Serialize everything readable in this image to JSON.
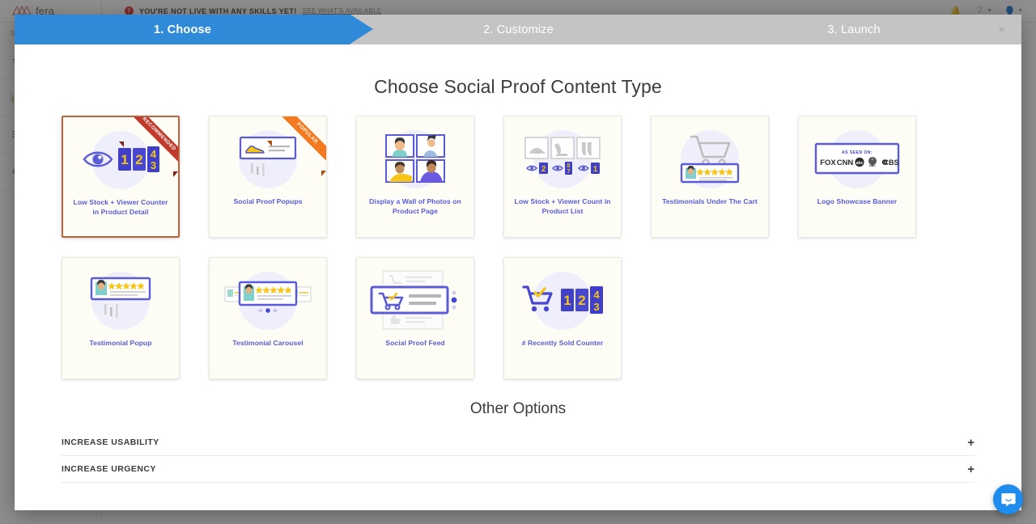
{
  "background": {
    "brand_name": "fera",
    "alert": {
      "icon": "alert-bell-icon",
      "text": "YOU'RE NOT LIVE WITH ANY SKILLS YET!",
      "link_text": "SEE WHAT'S AVAILABLE"
    },
    "topbar_icons": [
      "bell-icon",
      "help-icon",
      "user-avatar-icon"
    ],
    "sidebar": {
      "heading": "SKILLS",
      "items": [
        {
          "label": "",
          "icon": "star-icon"
        },
        {
          "label": "",
          "icon": "chart-icon"
        },
        {
          "label": "",
          "icon": "list-icon"
        },
        {
          "label": "",
          "icon": "gear-icon"
        }
      ]
    }
  },
  "modal": {
    "close_label": "×",
    "steps": [
      {
        "number": "1.",
        "label": "1. Choose",
        "active": true
      },
      {
        "number": "2.",
        "label": "2. Customize",
        "active": false
      },
      {
        "number": "3.",
        "label": "3. Launch",
        "active": false
      }
    ],
    "title": "Choose Social Proof Content Type",
    "cards": [
      {
        "label": "Low Stock + Viewer Counter in Product Detail",
        "art": "eye-counter-digits",
        "ribbon": "RECOMMENDED",
        "ribbon_type": "recommended",
        "selected": true,
        "digits": [
          "1",
          "2",
          "4",
          "3"
        ]
      },
      {
        "label": "Social Proof Popups",
        "art": "popup-shoe-card",
        "ribbon": "POPULAR",
        "ribbon_type": "popular",
        "selected": false
      },
      {
        "label": "Display a Wall of Photos on Product Page",
        "art": "photo-wall-grid",
        "ribbon": null,
        "selected": false
      },
      {
        "label": "Low Stock + Viewer Count in Product List",
        "art": "product-list-viewers",
        "ribbon": null,
        "selected": false,
        "view_counts": [
          "2",
          "",
          "1"
        ]
      },
      {
        "label": "Testimonials Under The Cart",
        "art": "cart-testimonial",
        "ribbon": null,
        "selected": false
      },
      {
        "label": "Logo Showcase Banner",
        "art": "logo-banner",
        "ribbon": null,
        "selected": false,
        "banner_caption": "AS SEEN ON:",
        "banner_logos": [
          "FOX",
          "CNN",
          "abc",
          "NBC",
          "CBS"
        ]
      },
      {
        "label": "Testimonial Popup",
        "art": "testimonial-popup",
        "ribbon": null,
        "selected": false
      },
      {
        "label": "Testimonial Carousel",
        "art": "testimonial-carousel",
        "ribbon": null,
        "selected": false
      },
      {
        "label": "Social Proof Feed",
        "art": "social-proof-feed",
        "ribbon": null,
        "selected": false
      },
      {
        "label": "# Recently Sold Counter",
        "art": "cart-counter-digits",
        "ribbon": null,
        "selected": false,
        "digits": [
          "1",
          "2",
          "4",
          "3"
        ]
      }
    ],
    "other_options": {
      "title": "Other Options",
      "rows": [
        {
          "label": "INCREASE USABILITY",
          "toggle": "+"
        },
        {
          "label": "INCREASE URGENCY",
          "toggle": "+"
        }
      ]
    }
  },
  "widgets": {
    "intercom_label": "intercom-messenger"
  },
  "colors": {
    "step_active": "#2f8ad8",
    "step_inactive": "#c4c4c4",
    "card_label": "#5a5ad6",
    "selected_border": "#b5643f",
    "ribbon_recommended": "#c0392b",
    "ribbon_popular": "#f47920",
    "accent_purple": "#5b5bd6",
    "star_yellow": "#f5c518"
  }
}
